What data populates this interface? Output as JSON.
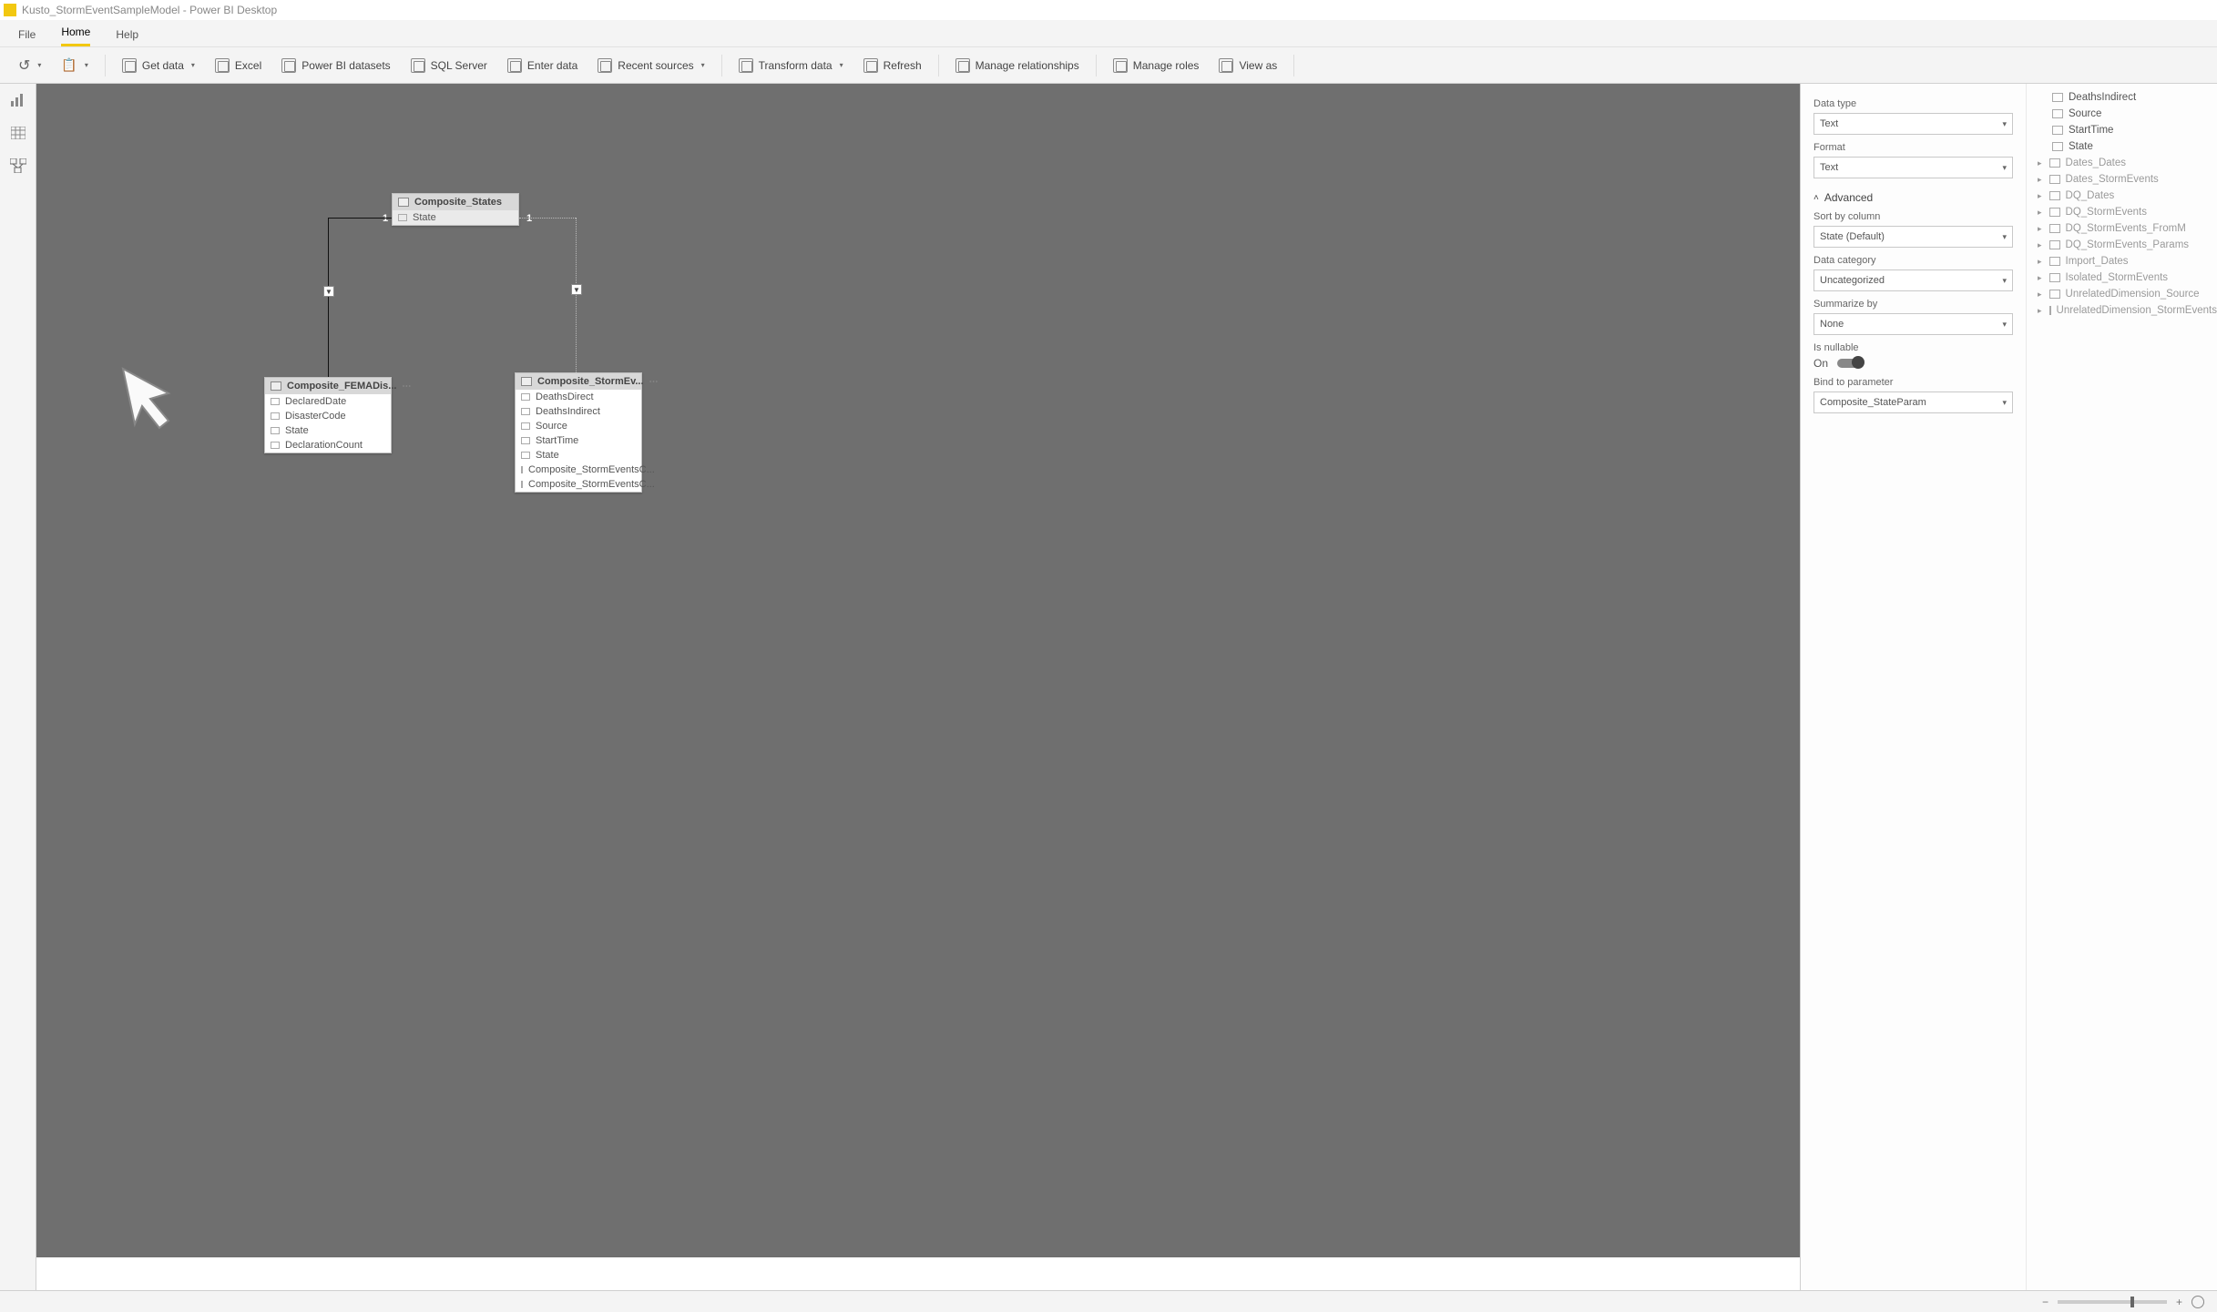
{
  "title": "Kusto_StormEventSampleModel - Power BI Desktop",
  "menu": {
    "file": "File",
    "home": "Home",
    "help": "Help"
  },
  "ribbon": {
    "get_data": "Get data",
    "excel": "Excel",
    "pbi_datasets": "Power BI datasets",
    "sql_server": "SQL Server",
    "enter_data": "Enter data",
    "recent_sources": "Recent sources",
    "transform_data": "Transform data",
    "refresh": "Refresh",
    "manage_relationships": "Manage relationships",
    "manage_roles": "Manage roles",
    "view_as": "View as"
  },
  "props": {
    "data_type_label": "Data type",
    "data_type_value": "Text",
    "format_label": "Format",
    "format_value": "Text",
    "advanced_label": "Advanced",
    "sort_by_label": "Sort by column",
    "sort_by_value": "State (Default)",
    "data_category_label": "Data category",
    "data_category_value": "Uncategorized",
    "summarize_label": "Summarize by",
    "summarize_value": "None",
    "is_nullable_label": "Is nullable",
    "is_nullable_value": "On",
    "bind_label": "Bind to parameter",
    "bind_value": "Composite_StateParam"
  },
  "fields_top": [
    "DeathsIndirect",
    "Source",
    "StartTime",
    "State"
  ],
  "fields_tables": [
    "Dates_Dates",
    "Dates_StormEvents",
    "DQ_Dates",
    "DQ_StormEvents",
    "DQ_StormEvents_FromM",
    "DQ_StormEvents_Params",
    "Import_Dates",
    "Isolated_StormEvents",
    "UnrelatedDimension_Source",
    "UnrelatedDimension_StormEvents"
  ],
  "entities": {
    "states": {
      "title": "Composite_States",
      "cols": [
        "State"
      ]
    },
    "fema": {
      "title": "Composite_FEMADis...",
      "cols": [
        "DeclaredDate",
        "DisasterCode",
        "State",
        "DeclarationCount"
      ]
    },
    "storm": {
      "title": "Composite_StormEv...",
      "cols": [
        "DeathsDirect",
        "DeathsIndirect",
        "Source",
        "StartTime",
        "State",
        "Composite_StormEventsC...",
        "Composite_StormEventsC..."
      ]
    }
  },
  "cardinality": {
    "left": "1",
    "right": "1"
  }
}
